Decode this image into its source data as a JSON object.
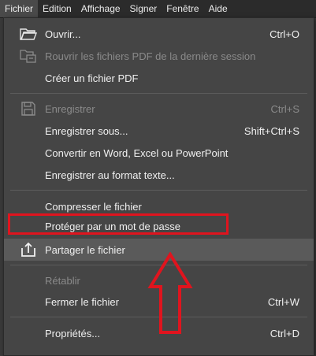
{
  "menubar": {
    "items": [
      "Fichier",
      "Edition",
      "Affichage",
      "Signer",
      "Fenêtre",
      "Aide"
    ]
  },
  "menu": {
    "open": {
      "label": "Ouvrir...",
      "shortcut": "Ctrl+O",
      "icon": "folder-open-icon"
    },
    "reopen": {
      "label": "Rouvrir les fichiers PDF de la dernière session",
      "icon": "reopen-files-icon"
    },
    "create_pdf": {
      "label": "Créer un fichier PDF"
    },
    "save": {
      "label": "Enregistrer",
      "shortcut": "Ctrl+S",
      "icon": "save-icon"
    },
    "save_as": {
      "label": "Enregistrer sous...",
      "shortcut": "Shift+Ctrl+S"
    },
    "convert": {
      "label": "Convertir en Word, Excel ou PowerPoint"
    },
    "save_text": {
      "label": "Enregistrer au format texte..."
    },
    "compress": {
      "label": "Compresser le fichier"
    },
    "protect": {
      "label": "Protéger par un mot de passe"
    },
    "share": {
      "label": "Partager le fichier",
      "icon": "share-icon"
    },
    "restore": {
      "label": "Rétablir"
    },
    "close": {
      "label": "Fermer le fichier",
      "shortcut": "Ctrl+W"
    },
    "properties": {
      "label": "Propriétés...",
      "shortcut": "Ctrl+D"
    }
  },
  "colors": {
    "annotation": "#e0141e",
    "menu_bg": "#454545",
    "disabled_text": "#8a8a8a"
  }
}
